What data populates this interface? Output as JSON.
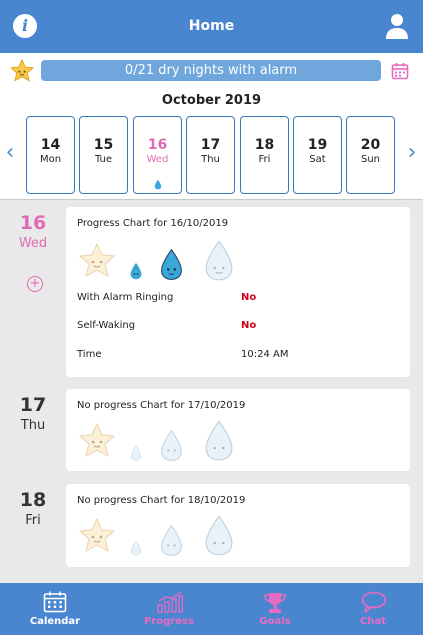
{
  "header": {
    "title": "Home",
    "info_label": "i"
  },
  "progress": {
    "text": "0/21 dry nights with alarm"
  },
  "calendar": {
    "month": "October 2019",
    "days": [
      {
        "num": "14",
        "name": "Mon"
      },
      {
        "num": "15",
        "name": "Tue"
      },
      {
        "num": "16",
        "name": "Wed"
      },
      {
        "num": "17",
        "name": "Thu"
      },
      {
        "num": "18",
        "name": "Fri"
      },
      {
        "num": "19",
        "name": "Sat"
      },
      {
        "num": "20",
        "name": "Sun"
      }
    ],
    "selected_index": 2
  },
  "entries": [
    {
      "num": "16",
      "day": "Wed",
      "title": "Progress Chart for 16/10/2019",
      "rows": [
        {
          "label": "With Alarm Ringing",
          "value": "No"
        },
        {
          "label": "Self-Waking",
          "value": "No"
        },
        {
          "label": "Time",
          "value": "10:24 AM"
        }
      ]
    },
    {
      "num": "17",
      "day": "Thu",
      "title": "No progress Chart for 17/10/2019"
    },
    {
      "num": "18",
      "day": "Fri",
      "title": "No progress Chart for 18/10/2019"
    }
  ],
  "add_label": "+",
  "tabs": [
    {
      "label": "Calendar",
      "icon": "calendar-icon",
      "active": true
    },
    {
      "label": "Progress",
      "icon": "chart-icon",
      "active": false
    },
    {
      "label": "Goals",
      "icon": "trophy-icon",
      "active": false
    },
    {
      "label": "Chat",
      "icon": "chat-bubble-icon",
      "active": false
    }
  ],
  "colors": {
    "brand_blue": "#4a86d0",
    "accent_pink": "#e06bb5",
    "alert_red": "#d0021b",
    "drop_active": "#3aa7d8"
  }
}
